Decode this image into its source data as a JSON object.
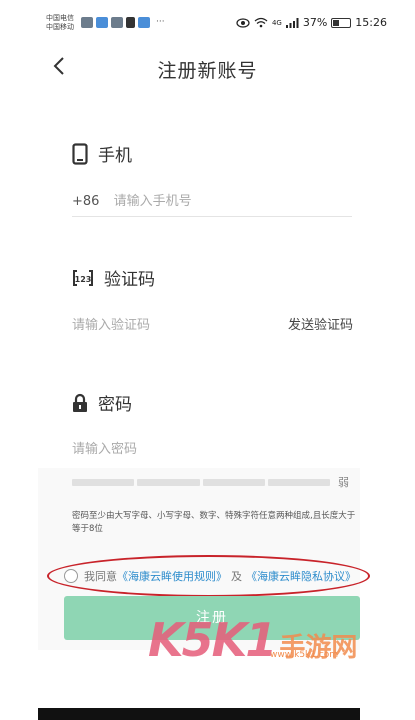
{
  "status_bar": {
    "carrier_1": "中国电信",
    "carrier_2": "中国移动",
    "dots": "···",
    "signal_text": "4G",
    "battery": "37%",
    "time": "15:26"
  },
  "header": {
    "title": "注册新账号"
  },
  "phone": {
    "label": "手机",
    "prefix": "+86",
    "placeholder": "请输入手机号"
  },
  "code": {
    "label": "验证码",
    "placeholder": "请输入验证码",
    "send": "发送验证码"
  },
  "password": {
    "label": "密码",
    "placeholder": "请输入密码",
    "strength": "弱",
    "hint": "密码至少由大写字母、小写字母、数字、特殊字符任意两种组成,且长度大于等于8位"
  },
  "agreement": {
    "prefix": "我同意",
    "terms": "《海康云眸使用规则》",
    "and": "及",
    "privacy": "《海康云眸隐私协议》"
  },
  "register_button": "注册",
  "watermark": {
    "logo": "K5K1",
    "text": "手游网",
    "url": "www.k5k1.com"
  },
  "colors": {
    "accent": "#8fd6b4",
    "link": "#2d8ccc",
    "highlight": "#c8232a"
  }
}
